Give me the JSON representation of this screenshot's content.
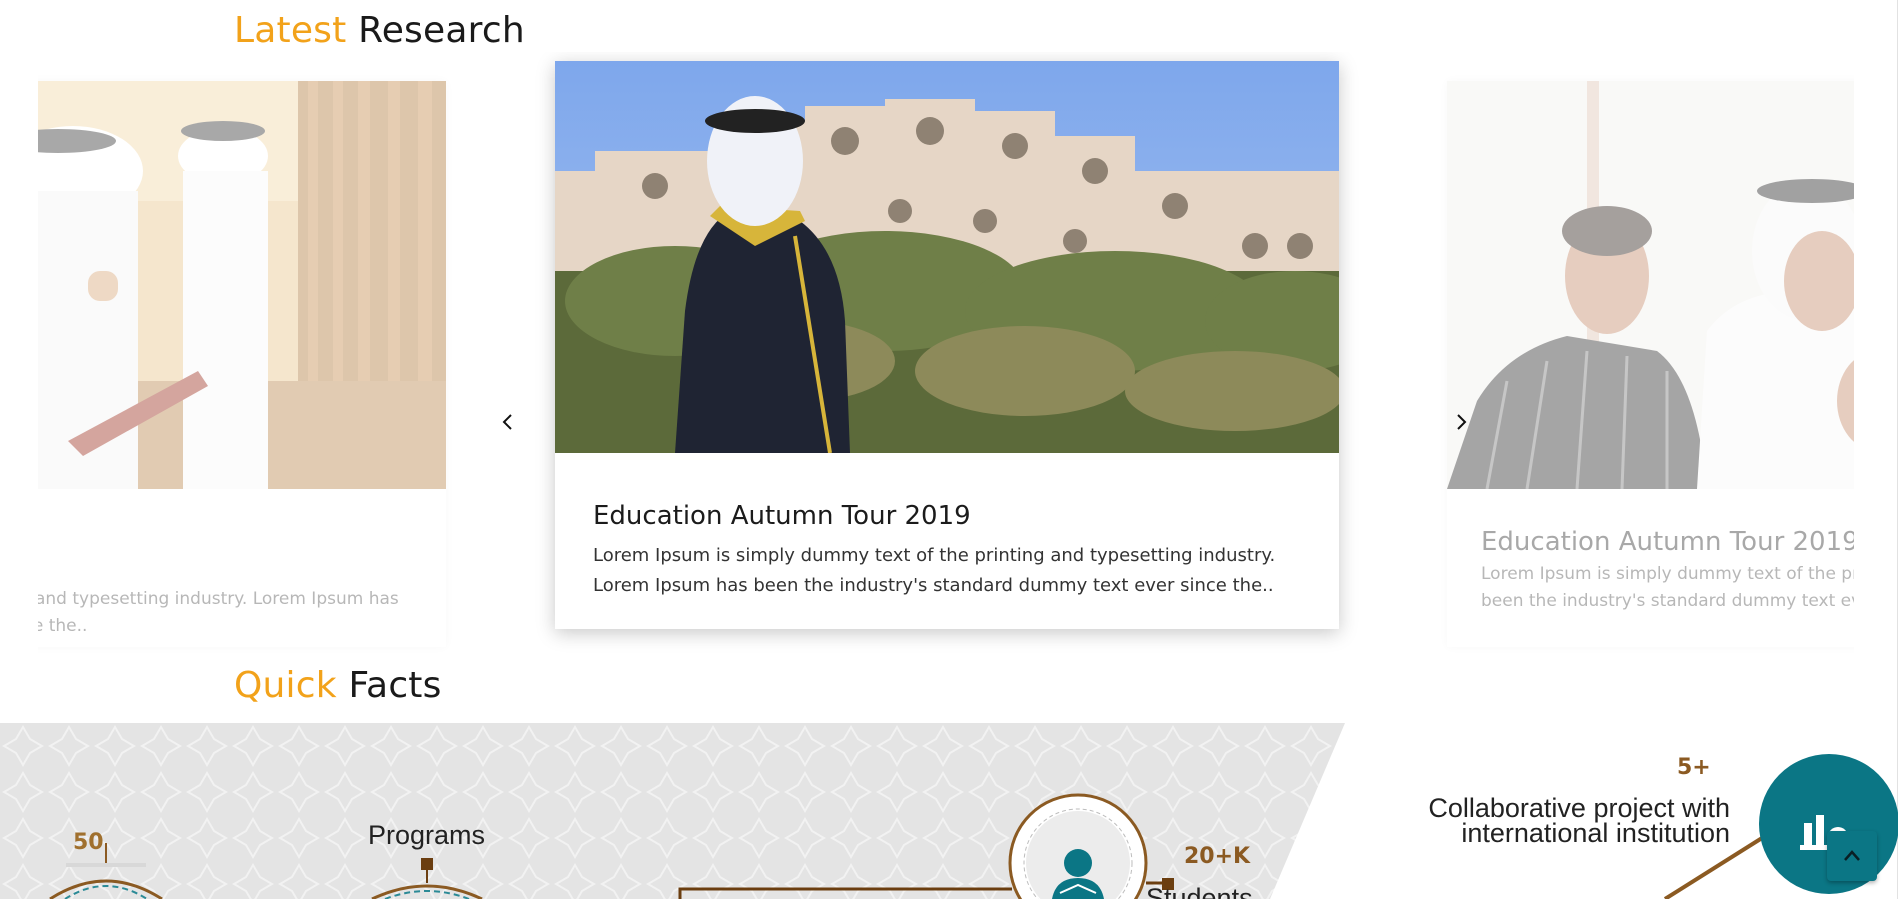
{
  "latest_research": {
    "title_accent": "Latest",
    "title_rest": "Research",
    "cards": [
      {
        "position": "previous",
        "title": "",
        "excerpt_line1": "ng and typesetting industry. Lorem Ipsum has",
        "excerpt_line2": "ince the.."
      },
      {
        "position": "current",
        "title": "Education Autumn Tour 2019",
        "excerpt_line1": "Lorem Ipsum is simply dummy text of the printing and typesetting industry.",
        "excerpt_line2": "Lorem Ipsum has been the industry's standard dummy text ever since the.."
      },
      {
        "position": "next",
        "title": "Education Autumn Tour 2019",
        "excerpt_line1": "Lorem Ipsum is simply dummy text of the printir",
        "excerpt_line2": "been the industry's standard dummy text ever s"
      }
    ],
    "prev_icon": "chevron-left-icon",
    "next_icon": "chevron-right-icon"
  },
  "quick_facts": {
    "title_accent": "Quick",
    "title_rest": "Facts",
    "items": [
      {
        "value": "50",
        "label": ""
      },
      {
        "value": "",
        "label": "Programs"
      },
      {
        "value": "20+K",
        "label": "Students"
      },
      {
        "value": "5+",
        "label_line1": "Collaborative project with",
        "label_line2": "international institution"
      }
    ],
    "feature_icon": "chart-icon",
    "back_to_top_icon": "chevron-up-icon"
  },
  "colors": {
    "accent": "#f2a21a",
    "fact_number": "#8b5a22",
    "teal": "#0b7685"
  }
}
